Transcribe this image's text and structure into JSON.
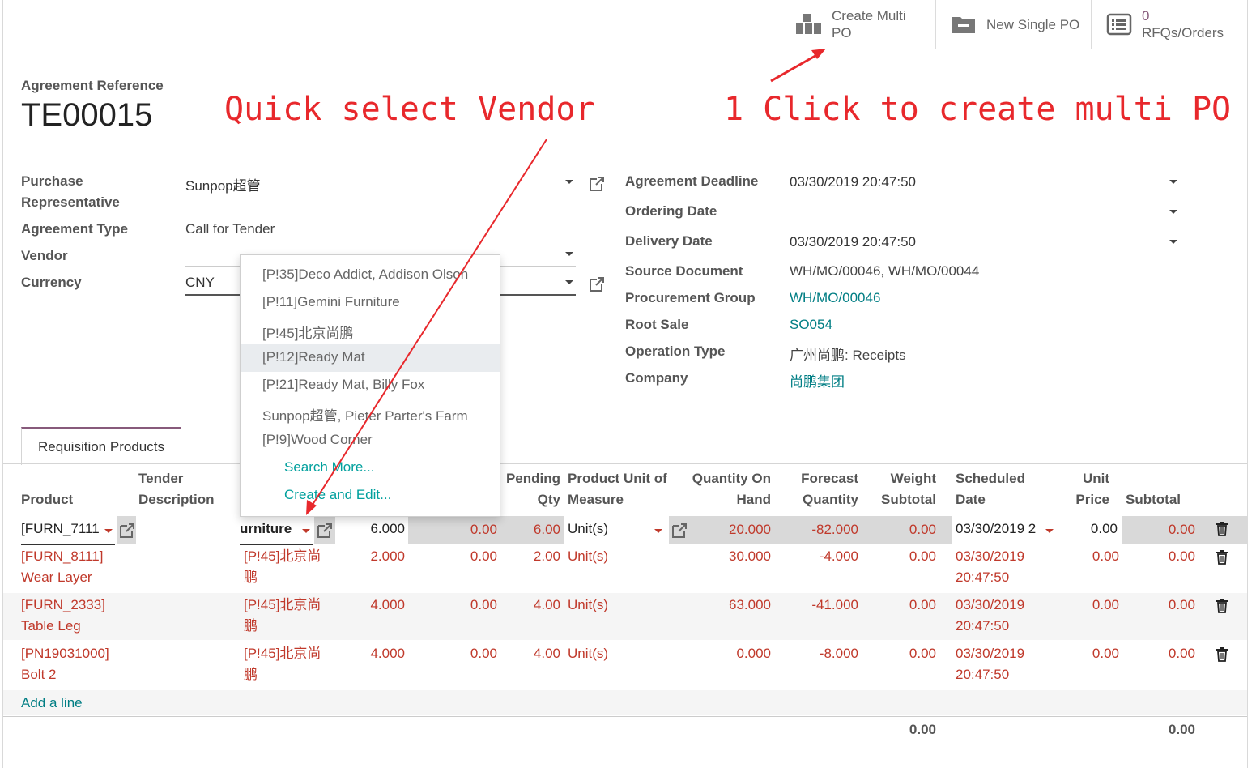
{
  "topbar": {
    "create_multi_po_line1": "Create Multi",
    "create_multi_po_line2": "PO",
    "new_single_po": "New Single PO",
    "rfq_count": "0",
    "rfq_label": "RFQs/Orders"
  },
  "header": {
    "ref_label": "Agreement Reference",
    "ref_value": "TE00015"
  },
  "annotations": {
    "quick_select": "Quick select Vendor",
    "one_click": "1 Click to create multi PO"
  },
  "left_fields": {
    "purchase_rep_label_1": "Purchase",
    "purchase_rep_label_2": "Representative",
    "purchase_rep_value": "Sunpop超管",
    "agreement_type_label": "Agreement Type",
    "agreement_type_value": "Call for Tender",
    "vendor_label": "Vendor",
    "vendor_value": "",
    "currency_label": "Currency",
    "currency_value": "CNY"
  },
  "right_fields": {
    "deadline_label": "Agreement Deadline",
    "deadline_value": "03/30/2019 20:47:50",
    "ordering_label": "Ordering Date",
    "ordering_value": "",
    "delivery_label": "Delivery Date",
    "delivery_value": "03/30/2019 20:47:50",
    "source_label": "Source Document",
    "source_value": "WH/MO/00046, WH/MO/00044",
    "procurement_label": "Procurement Group",
    "procurement_value": "WH/MO/00046",
    "root_label": "Root Sale",
    "root_value": "SO054",
    "optype_label": "Operation Type",
    "optype_value": "广州尚鹏: Receipts",
    "company_label": "Company",
    "company_value": "尚鹏集团"
  },
  "vendor_dropdown": {
    "items": [
      "[P!35]Deco Addict, Addison Olson",
      "[P!11]Gemini Furniture",
      "[P!45]北京尚鹏",
      "[P!12]Ready Mat",
      "[P!21]Ready Mat, Billy Fox",
      "Sunpop超管, Pieter Parter's Farm",
      "[P!9]Wood Corner"
    ],
    "highlighted_index": 3,
    "search_more": "Search More...",
    "create_edit": "Create and Edit..."
  },
  "tab": {
    "label": "Requisition Products"
  },
  "table": {
    "headers": {
      "product": "Product",
      "tender_desc_1": "Tender",
      "tender_desc_2": "Description",
      "pending_1": "Pending",
      "pending_2": "Qty",
      "uom_1": "Product Unit of",
      "uom_2": "Measure",
      "qoh_1": "Quantity On",
      "qoh_2": "Hand",
      "forecast_1": "Forecast",
      "forecast_2": "Quantity",
      "weight_1": "Weight",
      "weight_2": "Subtotal",
      "sched_1": "Scheduled",
      "sched_2": "Date",
      "unitprice_1": "Unit",
      "unitprice_2": "Price",
      "subtotal": "Subtotal"
    },
    "edit_row": {
      "product": "[FURN_7111",
      "vendor": "urniture",
      "qty": "6.000",
      "ordered": "0.00",
      "pending": "6.00",
      "uom": "Unit(s)",
      "qoh": "20.000",
      "forecast": "-82.000",
      "weight": "0.00",
      "sched": "03/30/2019 2",
      "unit_price": "0.00",
      "subtotal": "0.00"
    },
    "rows": [
      {
        "product_1": "[FURN_8111]",
        "product_2": "Wear Layer",
        "vendor_1": "[P!45]北京尚",
        "vendor_2": "鹏",
        "qty": "2.000",
        "ordered": "0.00",
        "pending": "2.00",
        "uom": "Unit(s)",
        "qoh": "30.000",
        "forecast": "-4.000",
        "weight": "0.00",
        "sched_1": "03/30/2019",
        "sched_2": "20:47:50",
        "unit_price": "0.00",
        "subtotal": "0.00"
      },
      {
        "product_1": "[FURN_2333]",
        "product_2": "Table Leg",
        "vendor_1": "[P!45]北京尚",
        "vendor_2": "鹏",
        "qty": "4.000",
        "ordered": "0.00",
        "pending": "4.00",
        "uom": "Unit(s)",
        "qoh": "63.000",
        "forecast": "-41.000",
        "weight": "0.00",
        "sched_1": "03/30/2019",
        "sched_2": "20:47:50",
        "unit_price": "0.00",
        "subtotal": "0.00"
      },
      {
        "product_1": "[PN19031000]",
        "product_2": "Bolt 2",
        "vendor_1": "[P!45]北京尚",
        "vendor_2": "鹏",
        "qty": "4.000",
        "ordered": "0.00",
        "pending": "4.00",
        "uom": "Unit(s)",
        "qoh": "0.000",
        "forecast": "-8.000",
        "weight": "0.00",
        "sched_1": "03/30/2019",
        "sched_2": "20:47:50",
        "unit_price": "0.00",
        "subtotal": "0.00"
      }
    ],
    "add_line": "Add a line",
    "total_weight": "0.00",
    "total_subtotal": "0.00"
  },
  "colors": {
    "accent_purple": "#875a7b",
    "link_teal": "#017e84",
    "annotation_red": "#e8282c",
    "row_red": "#c0392b"
  }
}
